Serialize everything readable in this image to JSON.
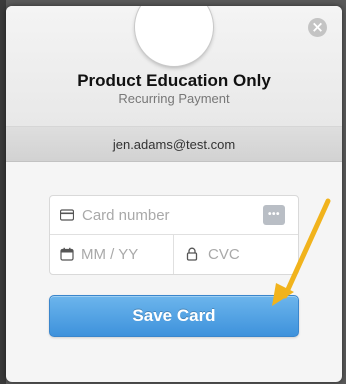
{
  "modal": {
    "title": "Product Education Only",
    "subtitle": "Recurring Payment",
    "close_icon": "close-icon",
    "close_glyph": "×",
    "email": "jen.adams@test.com"
  },
  "form": {
    "card_number_placeholder": "Card number",
    "expiry_placeholder": "MM / YY",
    "cvc_placeholder": "CVC",
    "card_brand_glyph": "•••",
    "icons": {
      "card_number": "credit-card-icon",
      "expiry": "calendar-icon",
      "cvc": "lock-icon",
      "brand": "card-brand-icon"
    }
  },
  "actions": {
    "save_label": "Save Card"
  },
  "colors": {
    "accent": "#3e92dc",
    "annotation_arrow": "#f1b31c"
  }
}
